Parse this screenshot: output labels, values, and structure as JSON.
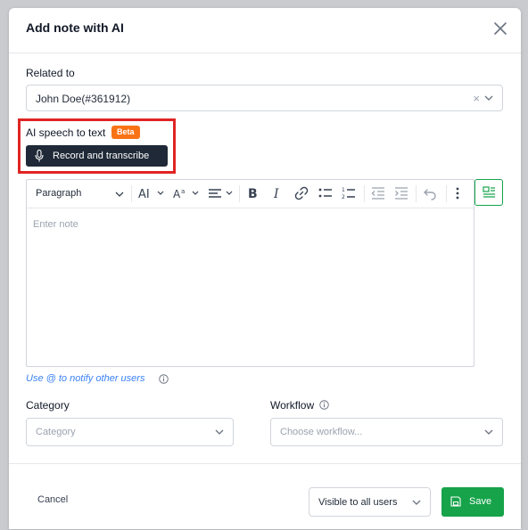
{
  "modal": {
    "title": "Add note with AI"
  },
  "related": {
    "label": "Related to",
    "value": "John Doe(#361912)",
    "clear_glyph": "×"
  },
  "ai_speech": {
    "label": "AI speech to text",
    "badge": "Beta",
    "button_label": "Record and transcribe"
  },
  "editor": {
    "paragraph_label": "Paragraph",
    "placeholder": "Enter note",
    "toolbar_icons": [
      "font-size-icon",
      "text-style-icon",
      "align-icon",
      "bold-icon",
      "italic-icon",
      "link-icon",
      "bullet-list-icon",
      "numbered-list-icon",
      "outdent-icon",
      "indent-icon",
      "undo-icon",
      "more-icon"
    ]
  },
  "hint": {
    "text": "Use @ to notify other users"
  },
  "category": {
    "label": "Category",
    "placeholder": "Category"
  },
  "workflow": {
    "label": "Workflow",
    "placeholder": "Choose workflow..."
  },
  "footer": {
    "cancel_label": "Cancel",
    "visibility_value": "Visible to all users",
    "save_label": "Save"
  },
  "colors": {
    "accent_green": "#16a34a",
    "badge_orange": "#f97316",
    "highlight_red": "#e02424",
    "dark_button": "#1f2937",
    "link_blue": "#3b82f6"
  }
}
